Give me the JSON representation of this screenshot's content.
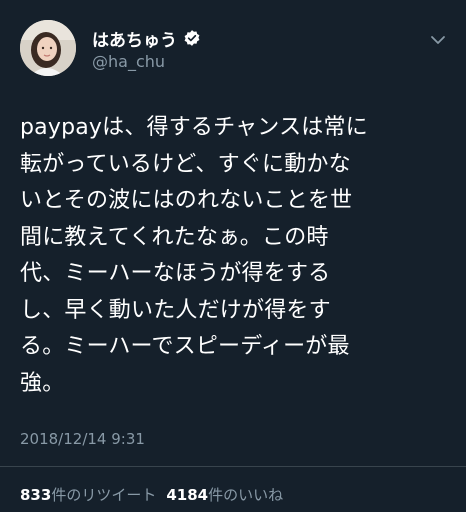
{
  "user": {
    "display_name": "はあちゅう",
    "handle": "@ha_chu",
    "verified": true
  },
  "tweet": {
    "lines": [
      "paypayは、得するチャンスは常に",
      "転がっているけど、すぐに動かな",
      "いとその波にはのれないことを世",
      "間に教えてくれたなぁ。この時",
      "代、ミーハーなほうが得をする",
      "し、早く動いた人だけが得をす",
      "る。ミーハーでスピーディーが最",
      "強。"
    ],
    "timestamp": "2018/12/14 9:31"
  },
  "stats": {
    "retweets_count": "833",
    "retweets_label": "件のリツイート",
    "likes_count": "4184",
    "likes_label": "件のいいね"
  },
  "icons": {
    "verified": "verified-badge-icon",
    "menu": "chevron-down-icon"
  },
  "colors": {
    "background": "#15202b",
    "text_primary": "#ffffff",
    "text_secondary": "#8899a6",
    "divider": "#38444d"
  }
}
